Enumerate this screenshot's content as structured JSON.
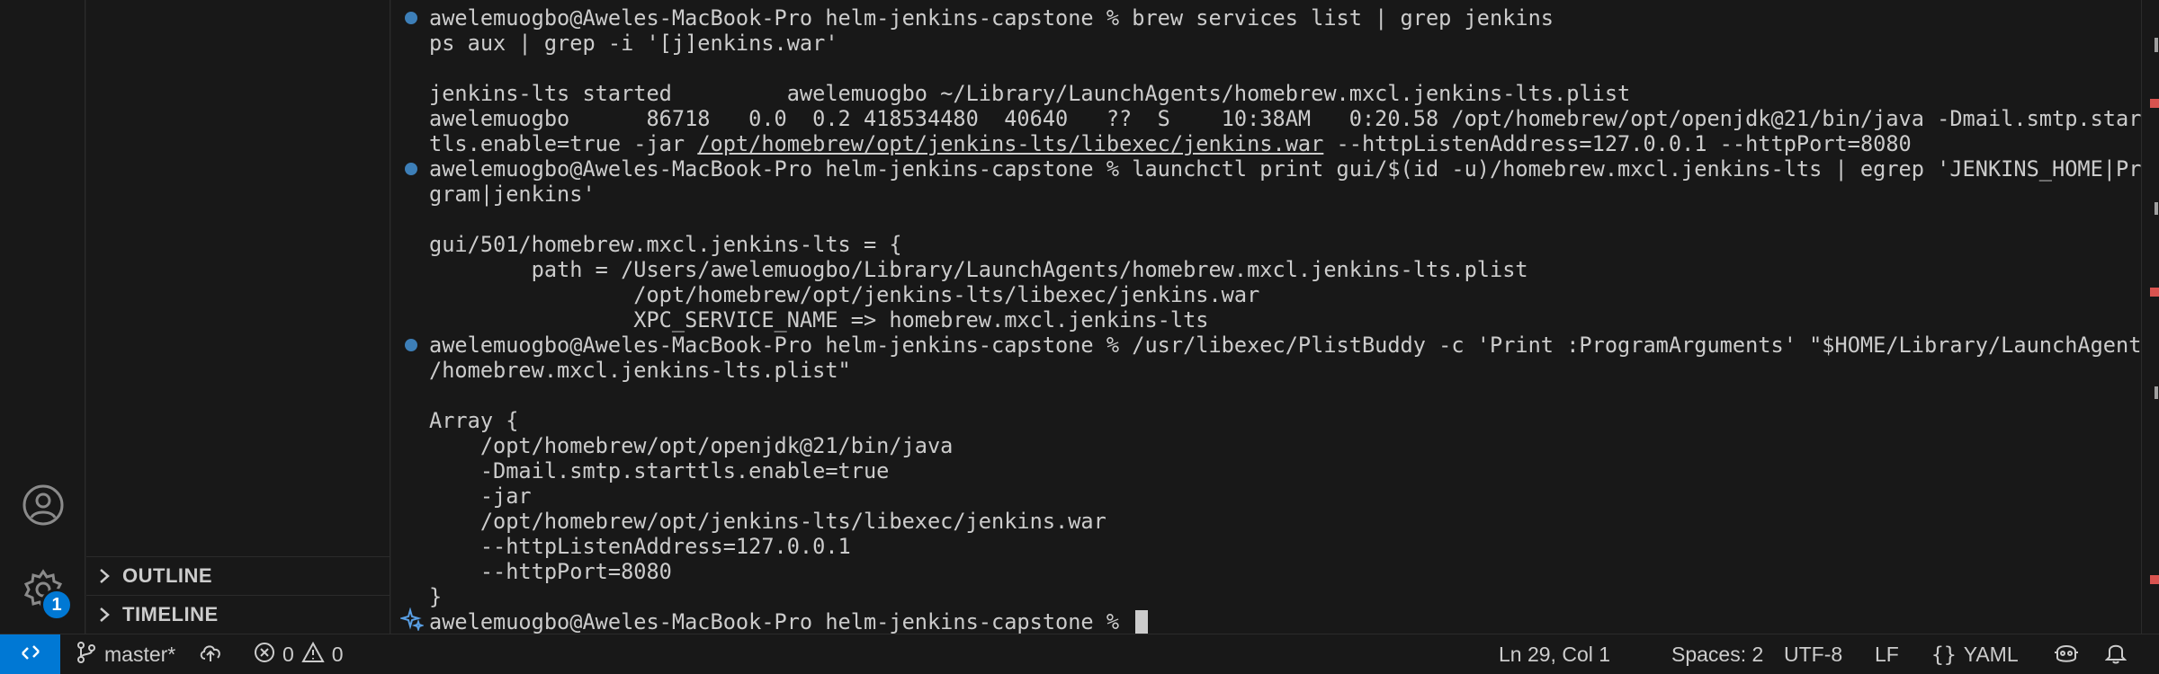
{
  "activity_bar": {
    "settings_badge": "1"
  },
  "side_bar": {
    "sections": [
      {
        "label": "OUTLINE"
      },
      {
        "label": "TIMELINE"
      }
    ]
  },
  "terminal": {
    "lines": [
      "awelemuogbo@Aweles-MacBook-Pro helm-jenkins-capstone % brew services list | grep jenkins",
      "ps aux | grep -i '[j]enkins.war'",
      "",
      "jenkins-lts started         awelemuogbo ~/Library/LaunchAgents/homebrew.mxcl.jenkins-lts.plist",
      "awelemuogbo      86718   0.0  0.2 418534480  40640   ??  S    10:38AM   0:20.58 /opt/homebrew/opt/openjdk@21/bin/java -Dmail.smtp.start",
      {
        "pre": "tls.enable=true -jar ",
        "link": "/opt/homebrew/opt/jenkins-lts/libexec/jenkins.war",
        "post": " --httpListenAddress=127.0.0.1 --httpPort=8080"
      },
      "awelemuogbo@Aweles-MacBook-Pro helm-jenkins-capstone % launchctl print gui/$(id -u)/homebrew.mxcl.jenkins-lts | egrep 'JENKINS_HOME|Pro",
      "gram|jenkins'",
      "",
      "gui/501/homebrew.mxcl.jenkins-lts = {",
      "        path = /Users/awelemuogbo/Library/LaunchAgents/homebrew.mxcl.jenkins-lts.plist",
      "                /opt/homebrew/opt/jenkins-lts/libexec/jenkins.war",
      "                XPC_SERVICE_NAME => homebrew.mxcl.jenkins-lts",
      "awelemuogbo@Aweles-MacBook-Pro helm-jenkins-capstone % /usr/libexec/PlistBuddy -c 'Print :ProgramArguments' \"$HOME/Library/LaunchAgents",
      "/homebrew.mxcl.jenkins-lts.plist\"",
      "",
      "Array {",
      "    /opt/homebrew/opt/openjdk@21/bin/java",
      "    -Dmail.smtp.starttls.enable=true",
      "    -jar",
      "    /opt/homebrew/opt/jenkins-lts/libexec/jenkins.war",
      "    --httpListenAddress=127.0.0.1",
      "    --httpPort=8080",
      "}",
      "awelemuogbo@Aweles-MacBook-Pro helm-jenkins-capstone % "
    ]
  },
  "status_bar": {
    "branch": "master*",
    "errors": "0",
    "warnings": "0",
    "cursor_position": "Ln 29, Col 1",
    "indentation": "Spaces: 2",
    "encoding": "UTF-8",
    "line_ending": "LF",
    "language": "YAML"
  },
  "colors": {
    "accent": "#0078d4",
    "command_marker": "#3d7fb8",
    "panel_background": "#181818",
    "text": "#cccccc"
  }
}
